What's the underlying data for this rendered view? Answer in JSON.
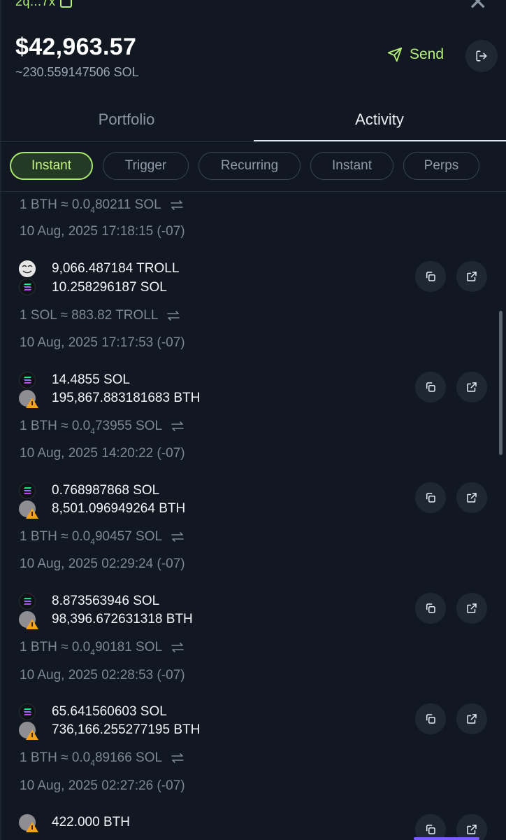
{
  "header": {
    "address": "2q...7x",
    "balance_usd": "$42,963.57",
    "balance_sol": "~230.559147506 SOL",
    "send_label": "Send",
    "close_icon": "close-icon",
    "logout_icon": "logout-icon"
  },
  "tabs": [
    {
      "label": "Portfolio",
      "active": false
    },
    {
      "label": "Activity",
      "active": true
    }
  ],
  "filters": [
    {
      "label": "Instant",
      "active": true
    },
    {
      "label": "Trigger",
      "active": false
    },
    {
      "label": "Recurring",
      "active": false
    },
    {
      "label": "Instant",
      "active": false
    },
    {
      "label": "Perps",
      "active": false
    }
  ],
  "activity": {
    "partial_top": {
      "rate_prefix": "1 BTH ≈ 0.0",
      "rate_sub": "4",
      "rate_suffix": "80211 SOL",
      "timestamp": "10 Aug, 2025 17:18:15 (-07)"
    },
    "items": [
      {
        "amount1": "9,066.487184 TROLL",
        "amount2": "10.258296187 SOL",
        "rate_prefix": "1 SOL ≈ 883.82 TROLL",
        "rate_sub": "",
        "rate_suffix": "",
        "timestamp": "10 Aug, 2025 17:17:53 (-07)"
      },
      {
        "amount1": "14.4855 SOL",
        "amount2": "195,867.883181683 BTH",
        "rate_prefix": "1 BTH ≈ 0.0",
        "rate_sub": "4",
        "rate_suffix": "73955 SOL",
        "timestamp": "10 Aug, 2025 14:20:22 (-07)"
      },
      {
        "amount1": "0.768987868 SOL",
        "amount2": "8,501.096949264 BTH",
        "rate_prefix": "1 BTH ≈ 0.0",
        "rate_sub": "4",
        "rate_suffix": "90457 SOL",
        "timestamp": "10 Aug, 2025 02:29:24 (-07)"
      },
      {
        "amount1": "8.873563946 SOL",
        "amount2": "98,396.672631318 BTH",
        "rate_prefix": "1 BTH ≈ 0.0",
        "rate_sub": "4",
        "rate_suffix": "90181 SOL",
        "timestamp": "10 Aug, 2025 02:28:53 (-07)"
      },
      {
        "amount1": "65.641560603 SOL",
        "amount2": "736,166.255277195 BTH",
        "rate_prefix": "1 BTH ≈ 0.0",
        "rate_sub": "4",
        "rate_suffix": "89166 SOL",
        "timestamp": "10 Aug, 2025 02:27:26 (-07)"
      }
    ],
    "partial_bottom": {
      "amount1": "422.000 BTH"
    }
  },
  "colors": {
    "background": "#111821",
    "accent": "#b6f07a",
    "chip_active_bg": "#243a25"
  }
}
